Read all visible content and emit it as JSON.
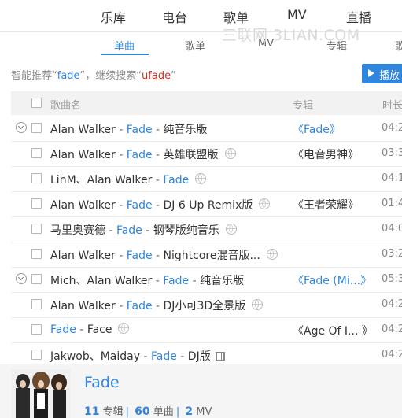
{
  "top_nav": [
    "乐库",
    "电台",
    "歌单",
    "MV",
    "直播"
  ],
  "sub_tabs": [
    "单曲",
    "歌单",
    "MV",
    "专辑",
    "歌"
  ],
  "watermark": "三联网 3LIAN.COM",
  "hint": {
    "prefix": "智能推荐“",
    "keyword": "fade",
    "middle": "”，继续搜索“",
    "keyword2": "ufade",
    "suffix": "”"
  },
  "play_all_label": "播放",
  "headers": {
    "song": "歌曲名",
    "album": "专辑",
    "duration": "时长"
  },
  "songs": [
    {
      "artist": "Alan Walker",
      "title": "Fade",
      "suffix": "纯音乐版",
      "album": "《Fade》",
      "album_link": true,
      "duration": "04:2",
      "expand": true,
      "globe": false,
      "mv": false
    },
    {
      "artist": "Alan Walker",
      "title": "Fade",
      "suffix": "英雄联盟版",
      "album": "《电音男神》",
      "album_link": false,
      "duration": "03:3",
      "expand": false,
      "globe": true,
      "mv": false
    },
    {
      "artist": "LinM、Alan Walker",
      "title": "Fade",
      "suffix": "",
      "album": "",
      "album_link": false,
      "duration": "04:1",
      "expand": false,
      "globe": true,
      "mv": false
    },
    {
      "artist": "Alan Walker",
      "title": "Fade",
      "suffix": "DJ 6 Up Remix版",
      "album": "《王者荣耀》",
      "album_link": false,
      "duration": "01:4",
      "expand": false,
      "globe": true,
      "mv": false
    },
    {
      "artist": "马里奥赛德",
      "title": "Fade",
      "suffix": "钢琴版纯音乐",
      "album": "",
      "album_link": false,
      "duration": "04:0",
      "expand": false,
      "globe": true,
      "mv": false
    },
    {
      "artist": "Alan Walker",
      "title": "Fade",
      "suffix": "Nightcore混音版...",
      "album": "",
      "album_link": false,
      "duration": "03:2",
      "expand": false,
      "globe": true,
      "mv": false
    },
    {
      "artist": "Mich、Alan Walker",
      "title": "Fade",
      "suffix": "纯音乐版",
      "album": "《Fade (Mi...》",
      "album_link": true,
      "duration": "05:3",
      "expand": true,
      "globe": false,
      "mv": false
    },
    {
      "artist": "Alan Walker",
      "title": "Fade",
      "suffix": "DJ小可3D全景版",
      "album": "",
      "album_link": false,
      "duration": "04:2",
      "expand": false,
      "globe": true,
      "mv": false
    },
    {
      "artist": "",
      "title": "Fade",
      "suffix": "Face",
      "album": "《Age Of I... 》",
      "album_link": false,
      "duration": "04:2",
      "expand": false,
      "globe": true,
      "mv": false
    },
    {
      "artist": "Jakwob、Maiday",
      "title": "Fade",
      "suffix": "DJ版",
      "album": "",
      "album_link": false,
      "duration": "04:2",
      "expand": false,
      "globe": false,
      "mv": true
    }
  ],
  "artist_card": {
    "name": "Fade",
    "albums_count": "11",
    "albums_label": "专辑",
    "songs_count": "60",
    "songs_label": "单曲",
    "mv_count": "2",
    "mv_label": "MV"
  },
  "colors": {
    "accent": "#2e86de",
    "alert": "#c0392b"
  }
}
